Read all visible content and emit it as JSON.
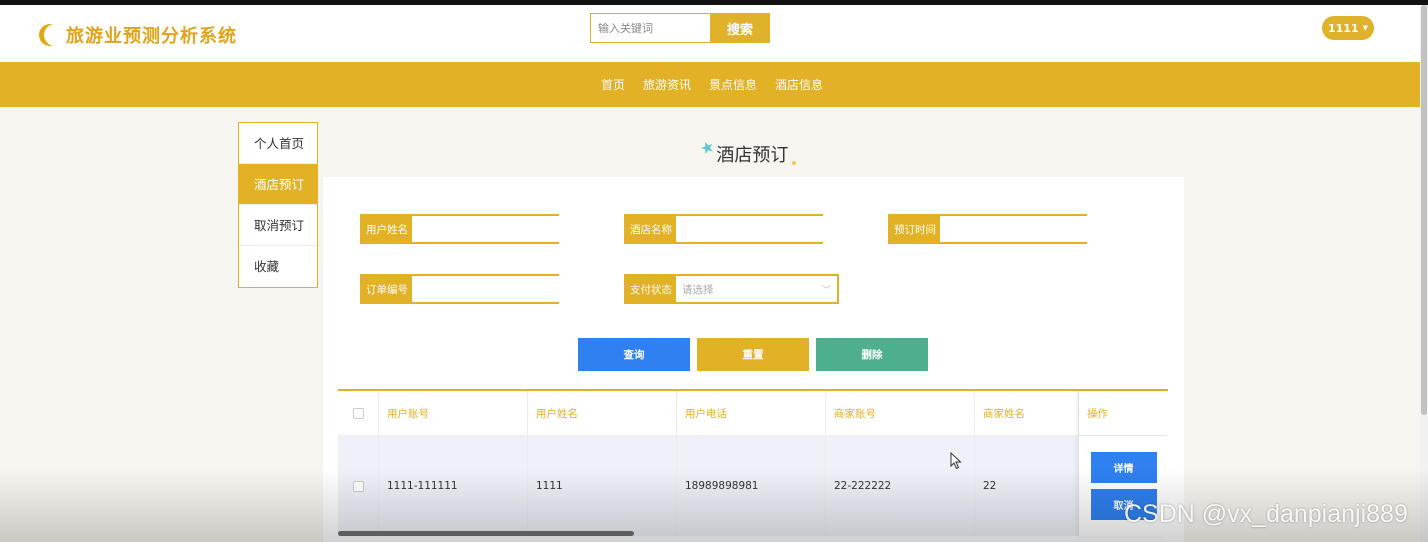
{
  "header": {
    "app_title": "旅游业预测分析系统",
    "search_placeholder": "输入关键词",
    "search_button": "搜索",
    "user_name": "1111"
  },
  "nav": {
    "items": [
      "首页",
      "旅游资讯",
      "景点信息",
      "酒店信息"
    ]
  },
  "sidebar": {
    "active_index": 1,
    "items": [
      "个人首页",
      "酒店预订",
      "取消预订",
      "收藏"
    ]
  },
  "page": {
    "heading": "酒店预订"
  },
  "filters": {
    "user_name_label": "用户姓名",
    "hotel_name_label": "酒店名称",
    "booking_time_label": "预订时间",
    "order_no_label": "订单编号",
    "pay_status_label": "支付状态",
    "pay_status_placeholder": "请选择"
  },
  "actions": {
    "query": "查询",
    "reset": "重置",
    "delete": "删除"
  },
  "table": {
    "columns": [
      "用户账号",
      "用户姓名",
      "用户电话",
      "商家账号",
      "商家姓名",
      "操作"
    ],
    "rows": [
      {
        "user_account": "1111-111111",
        "user_name": "1111",
        "user_phone": "18989898981",
        "merchant_account": "22-222222",
        "merchant_name": "22",
        "detail_button": "详情",
        "cancel_button": "取消"
      }
    ]
  },
  "watermark": "CSDN @vx_danpianji889",
  "colors": {
    "accent": "#e2b125",
    "primary_button": "#2f80f0",
    "delete_button": "#4eaf8e"
  }
}
